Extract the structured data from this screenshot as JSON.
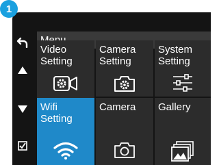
{
  "badge": "1",
  "menu": {
    "title": "Menu"
  },
  "side_buttons": [
    {
      "name": "back-icon"
    },
    {
      "name": "up-arrow-icon"
    },
    {
      "name": "down-arrow-icon"
    },
    {
      "name": "checkbox-icon"
    }
  ],
  "tiles": [
    {
      "label": "Video\nSetting",
      "icon": "video-setting-icon",
      "selected": false
    },
    {
      "label": "Camera\nSetting",
      "icon": "camera-setting-icon",
      "selected": false
    },
    {
      "label": "System\nSetting",
      "icon": "sliders-icon",
      "selected": false
    },
    {
      "label": "Wifi\nSetting",
      "icon": "wifi-icon",
      "selected": true
    },
    {
      "label": "Camera",
      "icon": "camera-icon",
      "selected": false
    },
    {
      "label": "Gallery",
      "icon": "gallery-icon",
      "selected": false
    }
  ],
  "colors": {
    "accent": "#1f89c9",
    "badge": "#1aa0df",
    "tile": "#2c2c2c",
    "background": "#141414"
  }
}
